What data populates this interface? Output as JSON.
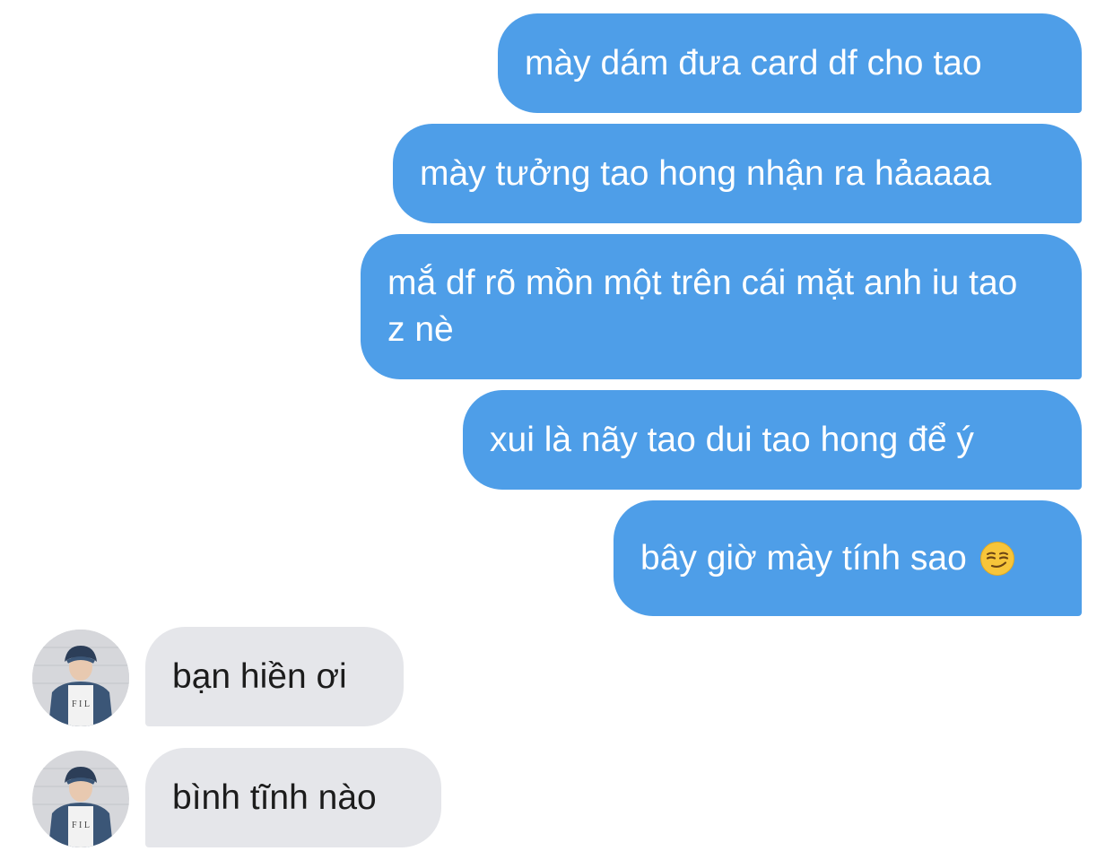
{
  "chat": {
    "outgoing": [
      {
        "text": "mày dám đưa card df cho tao"
      },
      {
        "text": "mày tưởng tao hong nhận ra hảaaaa"
      },
      {
        "text": "mắ df rõ mồn một trên cái mặt anh iu tao z nè"
      },
      {
        "text": "xui là nãy tao dui tao hong để ý"
      },
      {
        "text": "bây giờ mày tính sao",
        "emoji": "smirking-face-emoji"
      }
    ],
    "incoming": [
      {
        "text": "bạn hiền ơi",
        "avatar": "contact-avatar"
      },
      {
        "text": "bình tĩnh nào",
        "avatar": "contact-avatar"
      }
    ]
  },
  "colors": {
    "outgoing_bubble": "#4e9ee8",
    "incoming_bubble": "#e5e6ea",
    "outgoing_text": "#ffffff",
    "incoming_text": "#1c1c1c"
  }
}
